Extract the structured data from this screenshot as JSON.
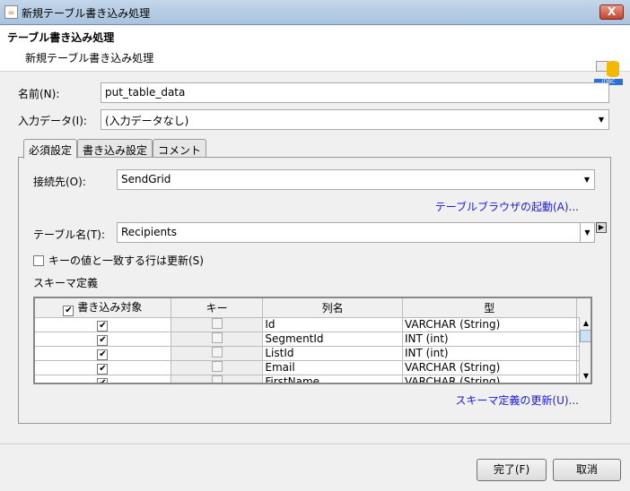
{
  "window": {
    "title": "新規テーブル書き込み処理",
    "close_label": "X"
  },
  "header": {
    "title": "テーブル書き込み処理",
    "subtitle": "新規テーブル書き込み処理",
    "badge": "JDBC"
  },
  "form": {
    "name_label": "名前(N):",
    "name_value": "put_table_data",
    "input_label": "入力データ(I):",
    "input_value": "(入力データなし)"
  },
  "tabs": [
    {
      "label": "必須設定"
    },
    {
      "label": "書き込み設定"
    },
    {
      "label": "コメント"
    }
  ],
  "required": {
    "conn_label": "接続先(O):",
    "conn_value": "SendGrid",
    "browser_link": "テーブルブラウザの起動(A)...",
    "table_label": "テーブル名(T):",
    "table_value": "Recipients",
    "update_label": "キーの値と一致する行は更新(S)",
    "update_checked": false,
    "schema_label": "スキーマ定義",
    "columns": [
      "書き込み対象",
      "キー",
      "列名",
      "型"
    ],
    "rows": [
      {
        "write": true,
        "key": false,
        "name": "Id",
        "type": "VARCHAR (String)"
      },
      {
        "write": true,
        "key": false,
        "name": "SegmentId",
        "type": "INT (int)"
      },
      {
        "write": true,
        "key": false,
        "name": "ListId",
        "type": "INT (int)"
      },
      {
        "write": true,
        "key": false,
        "name": "Email",
        "type": "VARCHAR (String)"
      },
      {
        "write": true,
        "key": false,
        "name": "FirstName",
        "type": "VARCHAR (String)"
      }
    ],
    "update_link": "スキーマ定義の更新(U)..."
  },
  "buttons": {
    "finish": "完了(F)",
    "cancel": "取消"
  }
}
